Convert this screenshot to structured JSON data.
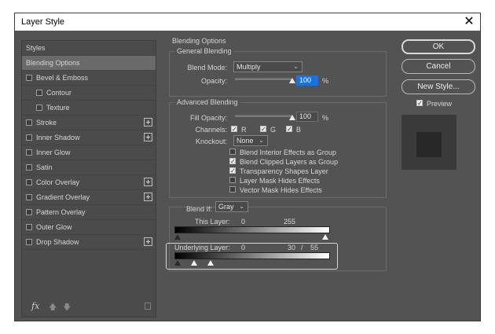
{
  "dialog": {
    "title": "Layer Style"
  },
  "styles_list": {
    "header": "Styles",
    "items": [
      {
        "label": "Blending Options",
        "checkbox": false,
        "checked": false,
        "selected": true,
        "plus": false,
        "indent": false
      },
      {
        "label": "Bevel & Emboss",
        "checkbox": true,
        "checked": false,
        "selected": false,
        "plus": false,
        "indent": false
      },
      {
        "label": "Contour",
        "checkbox": true,
        "checked": false,
        "selected": false,
        "plus": false,
        "indent": true
      },
      {
        "label": "Texture",
        "checkbox": true,
        "checked": false,
        "selected": false,
        "plus": false,
        "indent": true
      },
      {
        "label": "Stroke",
        "checkbox": true,
        "checked": false,
        "selected": false,
        "plus": true,
        "indent": false
      },
      {
        "label": "Inner Shadow",
        "checkbox": true,
        "checked": false,
        "selected": false,
        "plus": true,
        "indent": false
      },
      {
        "label": "Inner Glow",
        "checkbox": true,
        "checked": false,
        "selected": false,
        "plus": false,
        "indent": false
      },
      {
        "label": "Satin",
        "checkbox": true,
        "checked": false,
        "selected": false,
        "plus": false,
        "indent": false
      },
      {
        "label": "Color Overlay",
        "checkbox": true,
        "checked": false,
        "selected": false,
        "plus": true,
        "indent": false
      },
      {
        "label": "Gradient Overlay",
        "checkbox": true,
        "checked": false,
        "selected": false,
        "plus": true,
        "indent": false
      },
      {
        "label": "Pattern Overlay",
        "checkbox": true,
        "checked": false,
        "selected": false,
        "plus": false,
        "indent": false
      },
      {
        "label": "Outer Glow",
        "checkbox": true,
        "checked": false,
        "selected": false,
        "plus": false,
        "indent": false
      },
      {
        "label": "Drop Shadow",
        "checkbox": true,
        "checked": false,
        "selected": false,
        "plus": true,
        "indent": false
      }
    ],
    "fx_label": "fx",
    "icons": [
      "fx-icon",
      "move-up-icon",
      "move-down-icon",
      "trash-icon"
    ]
  },
  "blending": {
    "section_title": "Blending Options",
    "general": {
      "title": "General Blending",
      "blend_mode_label": "Blend Mode:",
      "blend_mode_value": "Multiply",
      "opacity_label": "Opacity:",
      "opacity_value": "100",
      "opacity_unit": "%",
      "opacity_level": 1.0
    },
    "advanced": {
      "title": "Advanced Blending",
      "fill_opacity_label": "Fill Opacity:",
      "fill_opacity_value": "100",
      "fill_opacity_unit": "%",
      "fill_opacity_level": 1.0,
      "channels_label": "Channels:",
      "channels": [
        {
          "label": "R",
          "checked": true
        },
        {
          "label": "G",
          "checked": true
        },
        {
          "label": "B",
          "checked": true
        }
      ],
      "knockout_label": "Knockout:",
      "knockout_value": "None",
      "options": [
        {
          "label": "Blend Interior Effects as Group",
          "checked": false
        },
        {
          "label": "Blend Clipped Layers as Group",
          "checked": true
        },
        {
          "label": "Transparency Shapes Layer",
          "checked": true
        },
        {
          "label": "Layer Mask Hides Effects",
          "checked": false
        },
        {
          "label": "Vector Mask Hides Effects",
          "checked": false
        }
      ]
    },
    "blend_if": {
      "label": "Blend If:",
      "value": "Gray",
      "this_layer": {
        "label": "This Layer:",
        "low": "0",
        "high": "255"
      },
      "underlying_layer": {
        "label": "Underlying Layer:",
        "low": "0",
        "split_low": "30",
        "separator": "/",
        "split_high": "55"
      }
    }
  },
  "buttons": {
    "ok": "OK",
    "cancel": "Cancel",
    "new_style": "New Style...",
    "preview_label": "Preview",
    "preview_checked": true
  },
  "colors": {
    "dialog_bg": "#535353",
    "accent_field": "#1473e6"
  }
}
